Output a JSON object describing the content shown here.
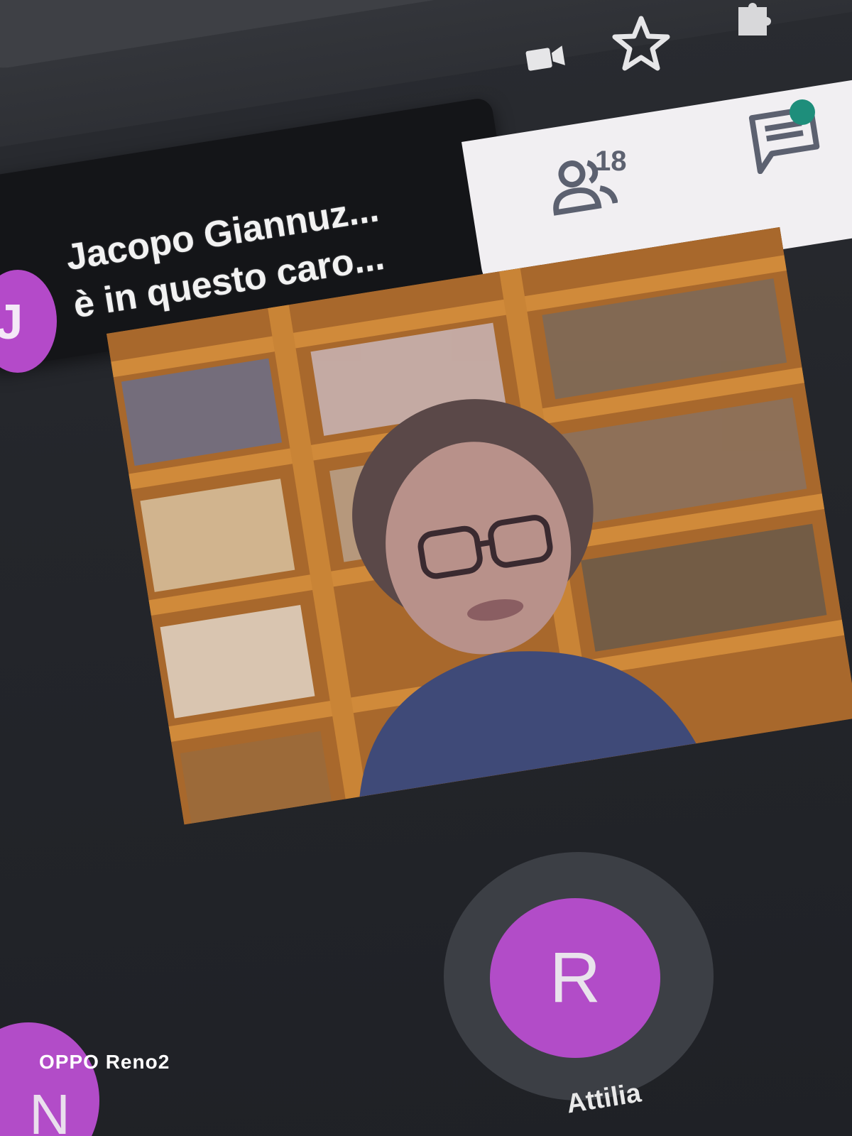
{
  "browser": {
    "icons": [
      "camera-icon",
      "star-icon",
      "extensions-icon"
    ]
  },
  "notification": {
    "avatar_initial": "J",
    "line1": "Jacopo Giannuz...",
    "line2": "è in questo caro..."
  },
  "panel": {
    "people_count": "18",
    "chat_has_unread": true
  },
  "participants": {
    "main_avatar_initial": "R",
    "main_name": "Attilia",
    "corner_avatar_initial": "N"
  },
  "watermark": "OPPO Reno2",
  "colors": {
    "avatar": "#b24cc8",
    "chat_dot": "#1e8e7b",
    "panel": "#f1eff2",
    "toast": "#141518"
  }
}
